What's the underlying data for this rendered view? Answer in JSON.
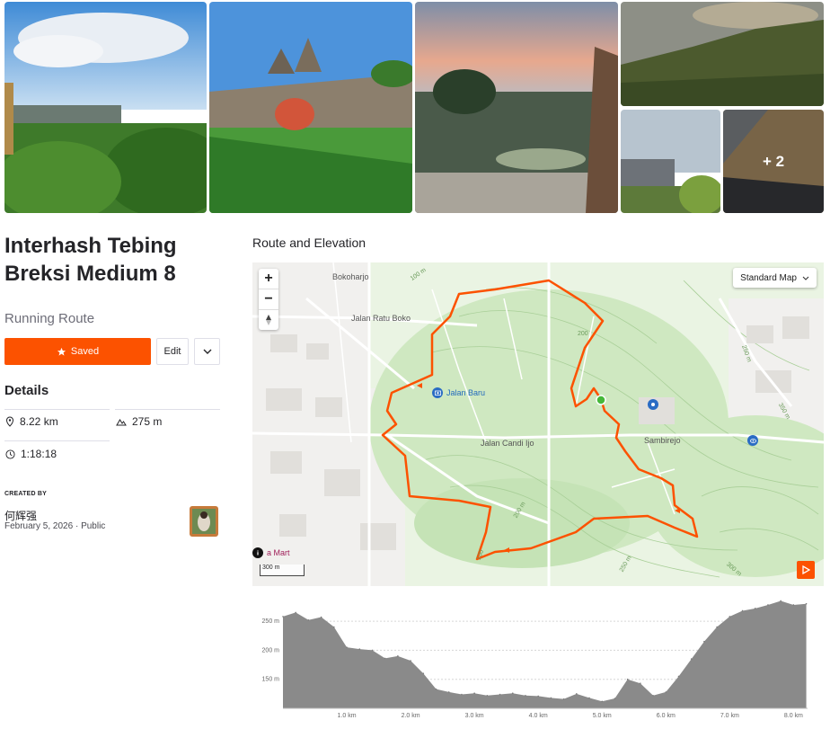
{
  "photos": {
    "more_label": "+ 2"
  },
  "route": {
    "title": "Interhash Tebing Breksi Medium 8",
    "type": "Running Route",
    "saved_label": "Saved",
    "edit_label": "Edit"
  },
  "details": {
    "heading": "Details",
    "distance": "8.22 km",
    "elevation_gain": "275 m",
    "duration": "1:18:18"
  },
  "creator": {
    "label": "CREATED BY",
    "name": "何辉强",
    "date": "February 5, 2026",
    "visibility": "Public"
  },
  "map": {
    "section_title": "Route and Elevation",
    "zoom_in": "+",
    "zoom_out": "−",
    "style_label": "Standard Map",
    "scale_label": "300 m",
    "places": {
      "bokoharjo": "Bokoharjo",
      "jalan_ratu_boko": "Jalan Ratu Boko",
      "jalan_baru": "Jalan Baru",
      "jalan_candi_ijo": "Jalan Candi Ijo",
      "sambirejo": "Sambirejo",
      "mart": "a Mart"
    },
    "contours": {
      "c1": "100 m",
      "c2": "200",
      "c3": "250 m",
      "c4": "350 m",
      "c5": "200 m",
      "c6": "250 m",
      "c7": "300 m",
      "c8": "100"
    },
    "route_color": "#fc5200"
  },
  "chart_data": {
    "type": "area",
    "x": [
      0.0,
      0.2,
      0.4,
      0.6,
      0.8,
      1.0,
      1.2,
      1.4,
      1.6,
      1.8,
      2.0,
      2.2,
      2.4,
      2.6,
      2.8,
      3.0,
      3.2,
      3.4,
      3.6,
      3.8,
      4.0,
      4.2,
      4.4,
      4.6,
      4.8,
      5.0,
      5.2,
      5.4,
      5.6,
      5.8,
      6.0,
      6.2,
      6.4,
      6.6,
      6.8,
      7.0,
      7.2,
      7.4,
      7.6,
      7.8,
      8.0,
      8.2
    ],
    "values": [
      258,
      265,
      252,
      257,
      240,
      205,
      202,
      200,
      186,
      190,
      182,
      160,
      133,
      128,
      124,
      126,
      122,
      124,
      126,
      122,
      121,
      118,
      116,
      125,
      118,
      112,
      117,
      150,
      143,
      122,
      128,
      155,
      185,
      215,
      240,
      258,
      268,
      272,
      278,
      285,
      278,
      280
    ],
    "xlabel": "",
    "ylabel": "",
    "xticks": [
      "1.0 km",
      "2.0 km",
      "3.0 km",
      "4.0 km",
      "5.0 km",
      "6.0 km",
      "7.0 km",
      "8.0 km"
    ],
    "xtick_values": [
      1,
      2,
      3,
      4,
      5,
      6,
      7,
      8
    ],
    "yticks": [
      "150 m",
      "200 m",
      "250 m"
    ],
    "ytick_values": [
      150,
      200,
      250
    ],
    "ylim": [
      100,
      295
    ],
    "xlim": [
      0,
      8.22
    ],
    "grid": true,
    "fill_color": "#8a8a8a"
  }
}
